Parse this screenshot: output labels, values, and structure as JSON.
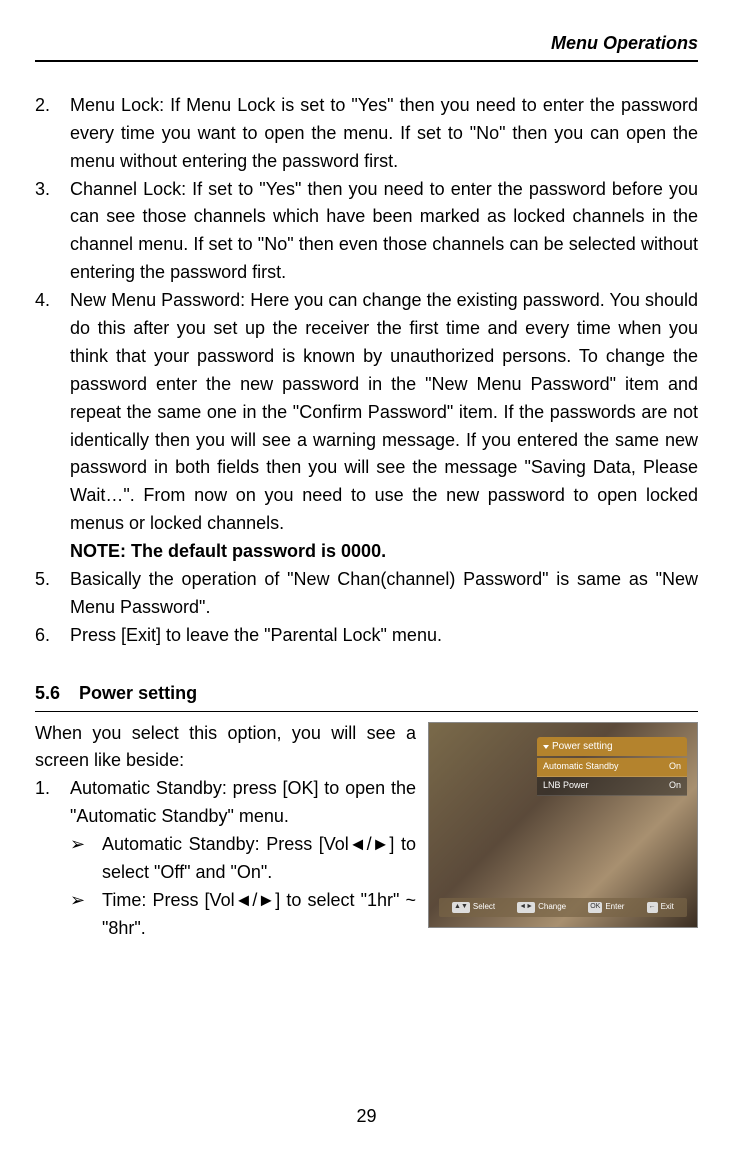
{
  "header": {
    "title": "Menu Operations"
  },
  "items": [
    {
      "num": "2.",
      "text": "Menu Lock: If Menu Lock is set to \"Yes\" then you need to enter the password every time you want to open the menu. If set to \"No\" then you can open the menu without entering the password first."
    },
    {
      "num": "3.",
      "text": "Channel Lock: If set to \"Yes\" then you need to enter the password before you can see those channels which have been marked as locked channels in the channel menu. If set to \"No\" then even those channels can be selected without entering the password first."
    },
    {
      "num": "4.",
      "text": "New Menu Password: Here you can change the existing password. You should do this after you set up the receiver the first time and every time when you think that your password is known by unauthorized persons. To change the password enter the new password in the \"New Menu Password\" item and repeat the same one in the \"Confirm Password\" item. If the passwords are not identically then you will see a warning message. If you entered the same new password in both fields then you will see the message \"Saving Data, Please Wait…\". From now on you need to use the new password to open locked menus or locked channels.",
      "note": "NOTE: The default password is 0000."
    },
    {
      "num": "5.",
      "text": "Basically the operation of \"New Chan(channel) Password\" is same as \"New Menu Password\"."
    },
    {
      "num": "6.",
      "text": "Press [Exit] to leave the \"Parental Lock\" menu."
    }
  ],
  "section": {
    "num": "5.6",
    "title": "Power setting",
    "intro": "When you select this option, you will see a screen like beside:",
    "list": [
      {
        "num": "1.",
        "text": "Automatic Standby: press [OK] to open the \"Automatic Standby\" menu.",
        "sub": [
          {
            "bullet": "➢",
            "text": "Automatic Standby: Press [Vol◄/►] to select \"Off\" and \"On\"."
          },
          {
            "bullet": "➢",
            "text": "Time: Press [Vol◄/►] to select \"1hr\" ~ \"8hr\"."
          }
        ]
      }
    ]
  },
  "screenshot": {
    "menu_title": "Power setting",
    "rows": [
      {
        "label": "Automatic Standby",
        "value": "On"
      },
      {
        "label": "LNB Power",
        "value": "On"
      }
    ],
    "footer": [
      {
        "key": "▲▼",
        "label": "Select"
      },
      {
        "key": "◄►",
        "label": "Change"
      },
      {
        "key": "OK",
        "label": "Enter"
      },
      {
        "key": "←",
        "label": "Exit"
      }
    ]
  },
  "page_number": "29"
}
